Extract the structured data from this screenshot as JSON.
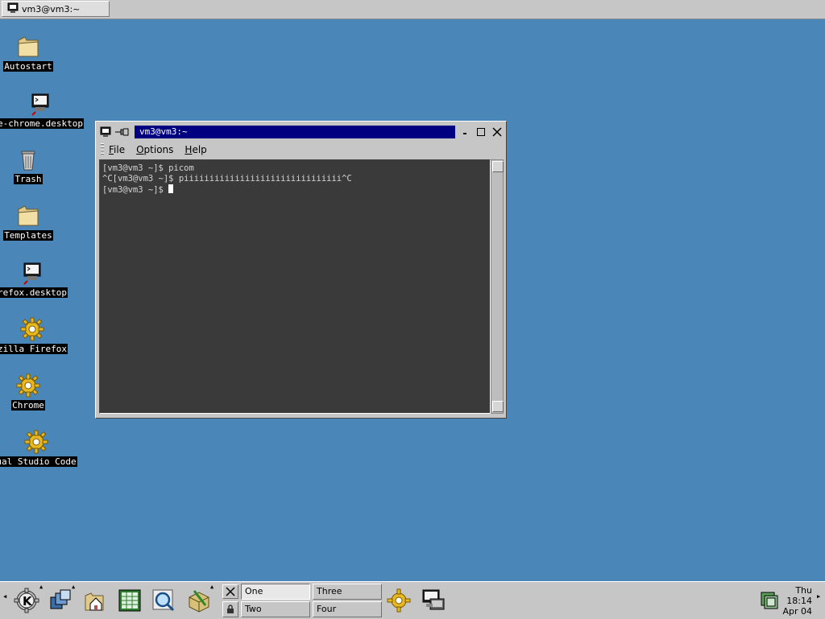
{
  "top_taskbar": {
    "task_label": "vm3@vm3:~"
  },
  "desktop_icons": [
    {
      "label": "Autostart",
      "icon": "folder-icon"
    },
    {
      "label": "e-chrome.desktop",
      "icon": "terminal-launcher-icon"
    },
    {
      "label": "Trash",
      "icon": "trash-icon"
    },
    {
      "label": "Templates",
      "icon": "folder-icon"
    },
    {
      "label": "refox.desktop",
      "icon": "terminal-launcher-icon"
    },
    {
      "label": "zilla Firefox",
      "icon": "gear-icon"
    },
    {
      "label": "Chrome",
      "icon": "gear-icon"
    },
    {
      "label": "ual Studio Code",
      "icon": "gear-icon"
    }
  ],
  "window": {
    "title": "vm3@vm3:~",
    "menu": [
      {
        "accel": "F",
        "rest": "ile"
      },
      {
        "accel": "O",
        "rest": "ptions"
      },
      {
        "accel": "H",
        "rest": "elp"
      }
    ],
    "terminal_lines": [
      "[vm3@vm3 ~]$ picom",
      "^C[vm3@vm3 ~]$ piiiiiiiiiiiiiiiiiiiiiiiiiiiiiii^C",
      "[vm3@vm3 ~]$ "
    ]
  },
  "panel": {
    "desktops": [
      "One",
      "Two",
      "Three",
      "Four"
    ],
    "active_desktop": "One",
    "clock": {
      "day": "Thu",
      "time": "18:14",
      "date": "Apr 04"
    }
  },
  "colors": {
    "desktop_bg": "#4a86b8",
    "title_active": "#000080",
    "terminal_bg": "#3a3a3a"
  }
}
